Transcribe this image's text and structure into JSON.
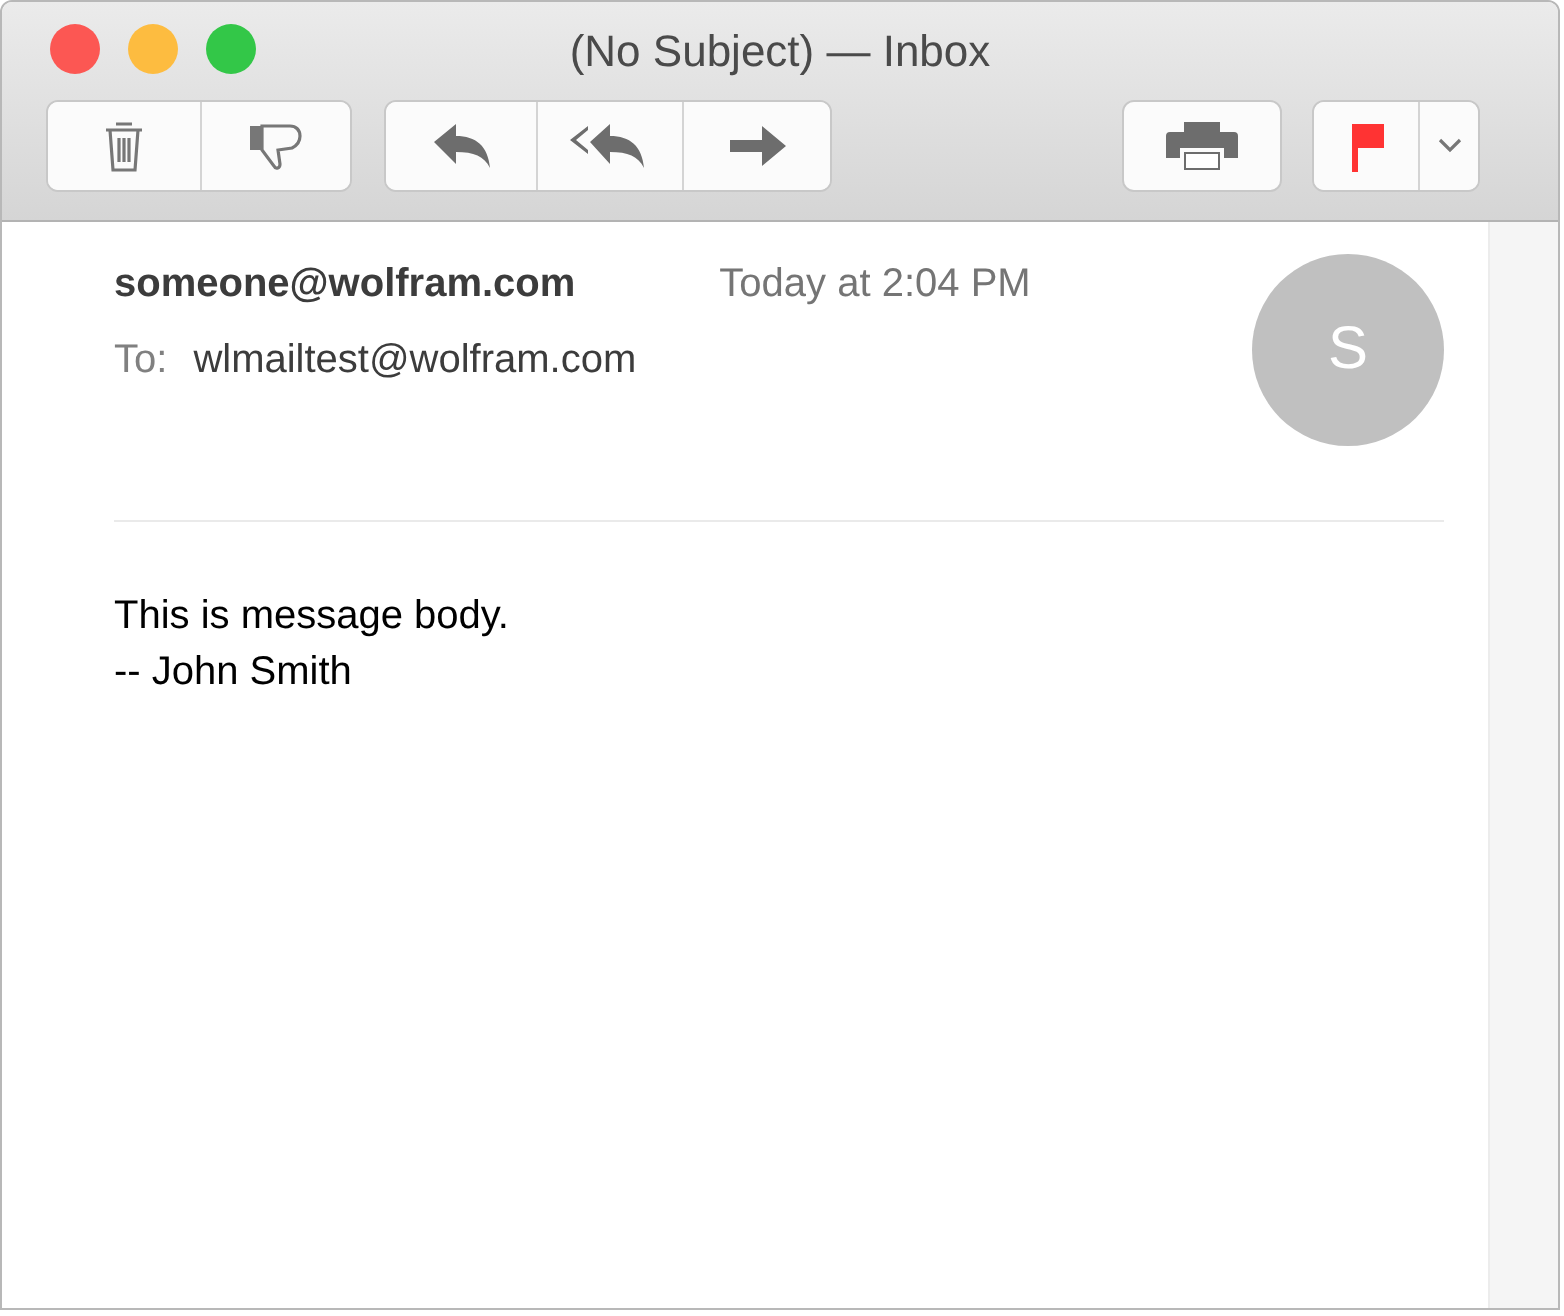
{
  "window": {
    "title": "(No Subject) — Inbox"
  },
  "message": {
    "from": "someone@wolfram.com",
    "date": "Today at 2:04 PM",
    "to_label": "To:",
    "to": "wlmailtest@wolfram.com",
    "avatar_initial": "S",
    "flagged": true,
    "body": [
      "This is message body.",
      "-- John Smith"
    ]
  }
}
